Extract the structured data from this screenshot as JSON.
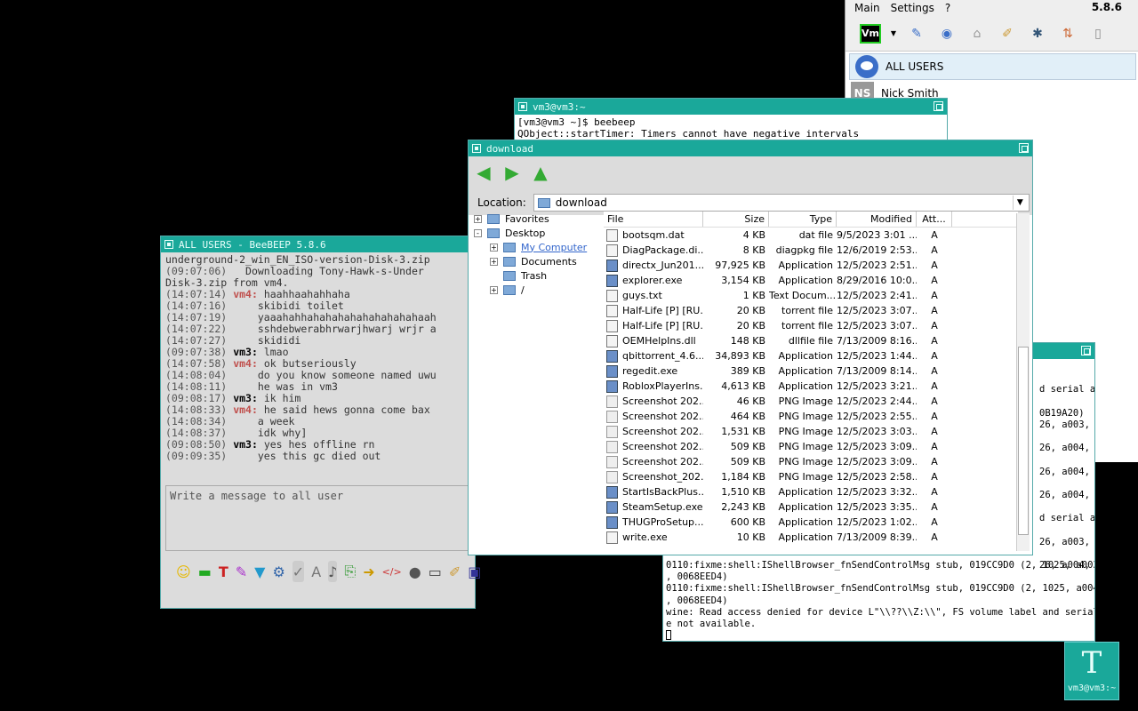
{
  "bee_main": {
    "menu": [
      "Main",
      "Settings",
      "?"
    ],
    "version": "5.8.6",
    "vm_label": "Vm",
    "users": [
      {
        "badge": "",
        "name": "ALL USERS"
      },
      {
        "badge": "NS",
        "name": "Nick Smith"
      }
    ]
  },
  "term1": {
    "title": "vm3@vm3:~",
    "lines": [
      "[vm3@vm3 ~]$ beebeep",
      "QObject::startTimer: Timers cannot have negative intervals"
    ]
  },
  "term2": {
    "top_lines": [
      "d serial ar",
      "",
      "0B19A20)",
      "26, a003, 0",
      "",
      "26, a004, 1",
      "",
      "26, a004, 1",
      "",
      "26, a004, 1",
      "",
      "d serial ar",
      "",
      "26, a003, 0",
      "",
      "26, a004, 1"
    ],
    "lines": [
      "0110:fixme:shell:IShellBrowser_fnSendControlMsg stub, 019CC9D0 (2, 1025, a003, 1",
      ", 0068EED4)",
      "0110:fixme:shell:IShellBrowser_fnSendControlMsg stub, 019CC9D0 (2, 1025, a004, 1",
      ", 0068EED4)",
      "wine: Read access denied for device L\"\\\\??\\\\Z:\\\\\", FS volume label and serial ar",
      "e not available."
    ]
  },
  "chat": {
    "title": "ALL USERS - BeeBEEP 5.8.6",
    "input_placeholder": "Write a message to all user",
    "log": [
      {
        "ts": "",
        "nick": "",
        "msg": "underground-2_win_EN_ISO-version-Disk-3.zip",
        "cls": ""
      },
      {
        "ts": "(09:07:06)",
        "nick": "",
        "msg": "  Downloading Tony-Hawk-s-Under",
        "cls": ""
      },
      {
        "ts": "",
        "nick": "",
        "msg": "Disk-3.zip from vm4.",
        "cls": ""
      },
      {
        "ts": "(14:07:14)",
        "nick": "vm4:",
        "msg": " haahhaahahhaha",
        "cls": "nm4"
      },
      {
        "ts": "(14:07:16)",
        "nick": "",
        "msg": "    skibidi toilet",
        "cls": ""
      },
      {
        "ts": "(14:07:19)",
        "nick": "",
        "msg": "    yaaahahhahahahahahahahahahaah",
        "cls": ""
      },
      {
        "ts": "(14:07:22)",
        "nick": "",
        "msg": "    sshdebwerabhrwarjhwarj wrjr a",
        "cls": ""
      },
      {
        "ts": "(14:07:27)",
        "nick": "",
        "msg": "    skididi",
        "cls": ""
      },
      {
        "ts": "(09:07:38)",
        "nick": "vm3:",
        "msg": " lmao",
        "cls": "nm3"
      },
      {
        "ts": "(14:07:58)",
        "nick": "vm4:",
        "msg": " ok butseriously",
        "cls": "nm4"
      },
      {
        "ts": "(14:08:04)",
        "nick": "",
        "msg": "    do you know someone named uwu",
        "cls": ""
      },
      {
        "ts": "(14:08:11)",
        "nick": "",
        "msg": "    he was in vm3",
        "cls": ""
      },
      {
        "ts": "(09:08:17)",
        "nick": "vm3:",
        "msg": " ik him",
        "cls": "nm3"
      },
      {
        "ts": "(14:08:33)",
        "nick": "vm4:",
        "msg": " he said hews gonna come bax",
        "cls": "nm4"
      },
      {
        "ts": "(14:08:34)",
        "nick": "",
        "msg": "    a week",
        "cls": ""
      },
      {
        "ts": "(14:08:37)",
        "nick": "",
        "msg": "    idk why]",
        "cls": ""
      },
      {
        "ts": "(09:08:50)",
        "nick": "vm3:",
        "msg": " yes hes offline rn",
        "cls": "nm3"
      },
      {
        "ts": "(09:09:35)",
        "nick": "",
        "msg": "    yes this gc died out",
        "cls": ""
      }
    ]
  },
  "fm": {
    "title": "download",
    "location_label": "Location:",
    "location_value": "download",
    "tree": [
      {
        "label": "Favorites",
        "indent": 0,
        "plus": "+"
      },
      {
        "label": "Desktop",
        "indent": 0,
        "plus": "-"
      },
      {
        "label": "My Computer",
        "indent": 1,
        "plus": "+"
      },
      {
        "label": "Documents",
        "indent": 1,
        "plus": "+"
      },
      {
        "label": "Trash",
        "indent": 1,
        "plus": ""
      },
      {
        "label": "/",
        "indent": 1,
        "plus": "+"
      }
    ],
    "columns": [
      "File",
      "Size",
      "Type",
      "Modified",
      "Att..."
    ],
    "files": [
      {
        "name": "bootsqm.dat",
        "size": "4 KB",
        "type": "dat file",
        "mod": "9/5/2023 3:01 ...",
        "att": "A",
        "icon": "doc"
      },
      {
        "name": "DiagPackage.di...",
        "size": "8 KB",
        "type": "diagpkg file",
        "mod": "12/6/2019 2:53...",
        "att": "A",
        "icon": "doc"
      },
      {
        "name": "directx_Jun201...",
        "size": "97,925 KB",
        "type": "Application",
        "mod": "12/5/2023 2:51...",
        "att": "A",
        "icon": "app"
      },
      {
        "name": "explorer.exe",
        "size": "3,154 KB",
        "type": "Application",
        "mod": "8/29/2016 10:0...",
        "att": "A",
        "icon": "app"
      },
      {
        "name": "guys.txt",
        "size": "1 KB",
        "type": "Text Docum...",
        "mod": "12/5/2023 2:41...",
        "att": "A",
        "icon": "doc"
      },
      {
        "name": "Half-Life [P] [RU...",
        "size": "20 KB",
        "type": "torrent file",
        "mod": "12/5/2023 3:07...",
        "att": "A",
        "icon": "doc"
      },
      {
        "name": "Half-Life [P] [RU...",
        "size": "20 KB",
        "type": "torrent file",
        "mod": "12/5/2023 3:07...",
        "att": "A",
        "icon": "doc"
      },
      {
        "name": "OEMHelpIns.dll",
        "size": "148 KB",
        "type": "dllfile file",
        "mod": "7/13/2009 8:16...",
        "att": "A",
        "icon": "doc"
      },
      {
        "name": "qbittorrent_4.6....",
        "size": "34,893 KB",
        "type": "Application",
        "mod": "12/5/2023 1:44...",
        "att": "A",
        "icon": "app"
      },
      {
        "name": "regedit.exe",
        "size": "389 KB",
        "type": "Application",
        "mod": "7/13/2009 8:14...",
        "att": "A",
        "icon": "app"
      },
      {
        "name": "RobloxPlayerIns...",
        "size": "4,613 KB",
        "type": "Application",
        "mod": "12/5/2023 3:21...",
        "att": "A",
        "icon": "app"
      },
      {
        "name": "Screenshot 202...",
        "size": "46 KB",
        "type": "PNG Image",
        "mod": "12/5/2023 2:44...",
        "att": "A",
        "icon": "img"
      },
      {
        "name": "Screenshot 202...",
        "size": "464 KB",
        "type": "PNG Image",
        "mod": "12/5/2023 2:55...",
        "att": "A",
        "icon": "img"
      },
      {
        "name": "Screenshot 202...",
        "size": "1,531 KB",
        "type": "PNG Image",
        "mod": "12/5/2023 3:03...",
        "att": "A",
        "icon": "img"
      },
      {
        "name": "Screenshot 202...",
        "size": "509 KB",
        "type": "PNG Image",
        "mod": "12/5/2023 3:09...",
        "att": "A",
        "icon": "img"
      },
      {
        "name": "Screenshot 202...",
        "size": "509 KB",
        "type": "PNG Image",
        "mod": "12/5/2023 3:09...",
        "att": "A",
        "icon": "img"
      },
      {
        "name": "Screenshot_202...",
        "size": "1,184 KB",
        "type": "PNG Image",
        "mod": "12/5/2023 2:58...",
        "att": "A",
        "icon": "img"
      },
      {
        "name": "StartIsBackPlus...",
        "size": "1,510 KB",
        "type": "Application",
        "mod": "12/5/2023 3:32...",
        "att": "A",
        "icon": "app"
      },
      {
        "name": "SteamSetup.exe",
        "size": "2,243 KB",
        "type": "Application",
        "mod": "12/5/2023 3:35...",
        "att": "A",
        "icon": "app"
      },
      {
        "name": "THUGProSetup....",
        "size": "600 KB",
        "type": "Application",
        "mod": "12/5/2023 1:02...",
        "att": "A",
        "icon": "app"
      },
      {
        "name": "write.exe",
        "size": "10 KB",
        "type": "Application",
        "mod": "7/13/2009 8:39...",
        "att": "A",
        "icon": "doc"
      }
    ]
  },
  "taskbar": {
    "glyph": "T",
    "label": "vm3@vm3:~"
  }
}
